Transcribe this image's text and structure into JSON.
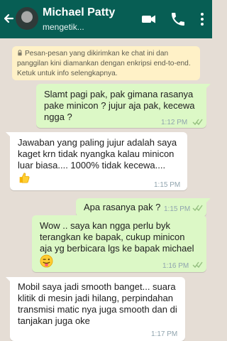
{
  "header": {
    "contact_name": "Michael Patty",
    "status": "mengetik...",
    "colors": {
      "bar": "#075e54",
      "text": "#ffffff"
    }
  },
  "chat": {
    "background": "#e5ddd5",
    "notice": "Pesan-pesan yang dikirimkan ke chat ini dan panggilan kini diamankan dengan enkripsi end-to-end. Ketuk untuk info selengkapnya.",
    "messages": [
      {
        "direction": "outgoing",
        "text": "Slamt pagi pak, pak gimana rasanya pake minicon ?  jujur aja pak, kecewa ngga ?",
        "time": "1:12 PM",
        "read_ticks": true
      },
      {
        "direction": "incoming",
        "text": "Jawaban yang paling jujur adalah saya kaget krn tidak nyangka kalau minicon luar biasa.... 1000% tidak kecewa....",
        "emoji": "thumbs-up",
        "time": "1:15 PM"
      },
      {
        "direction": "outgoing",
        "text": "Apa rasanya pak ?",
        "time": "1:15 PM",
        "read_ticks": true
      },
      {
        "direction": "outgoing",
        "text": "Wow .. saya kan ngga perlu byk terangkan ke bapak, cukup minicon aja yg berbicara lgs ke bapak michael",
        "emoji": "winking-tongue-face",
        "time": "1:16 PM",
        "read_ticks": true
      },
      {
        "direction": "incoming",
        "text": "Mobil saya jadi smooth banget... suara klitik di mesin jadi hilang, perpindahan transmisi matic nya juga smooth dan di tanjakan juga oke",
        "time": "1:17 PM"
      }
    ]
  }
}
